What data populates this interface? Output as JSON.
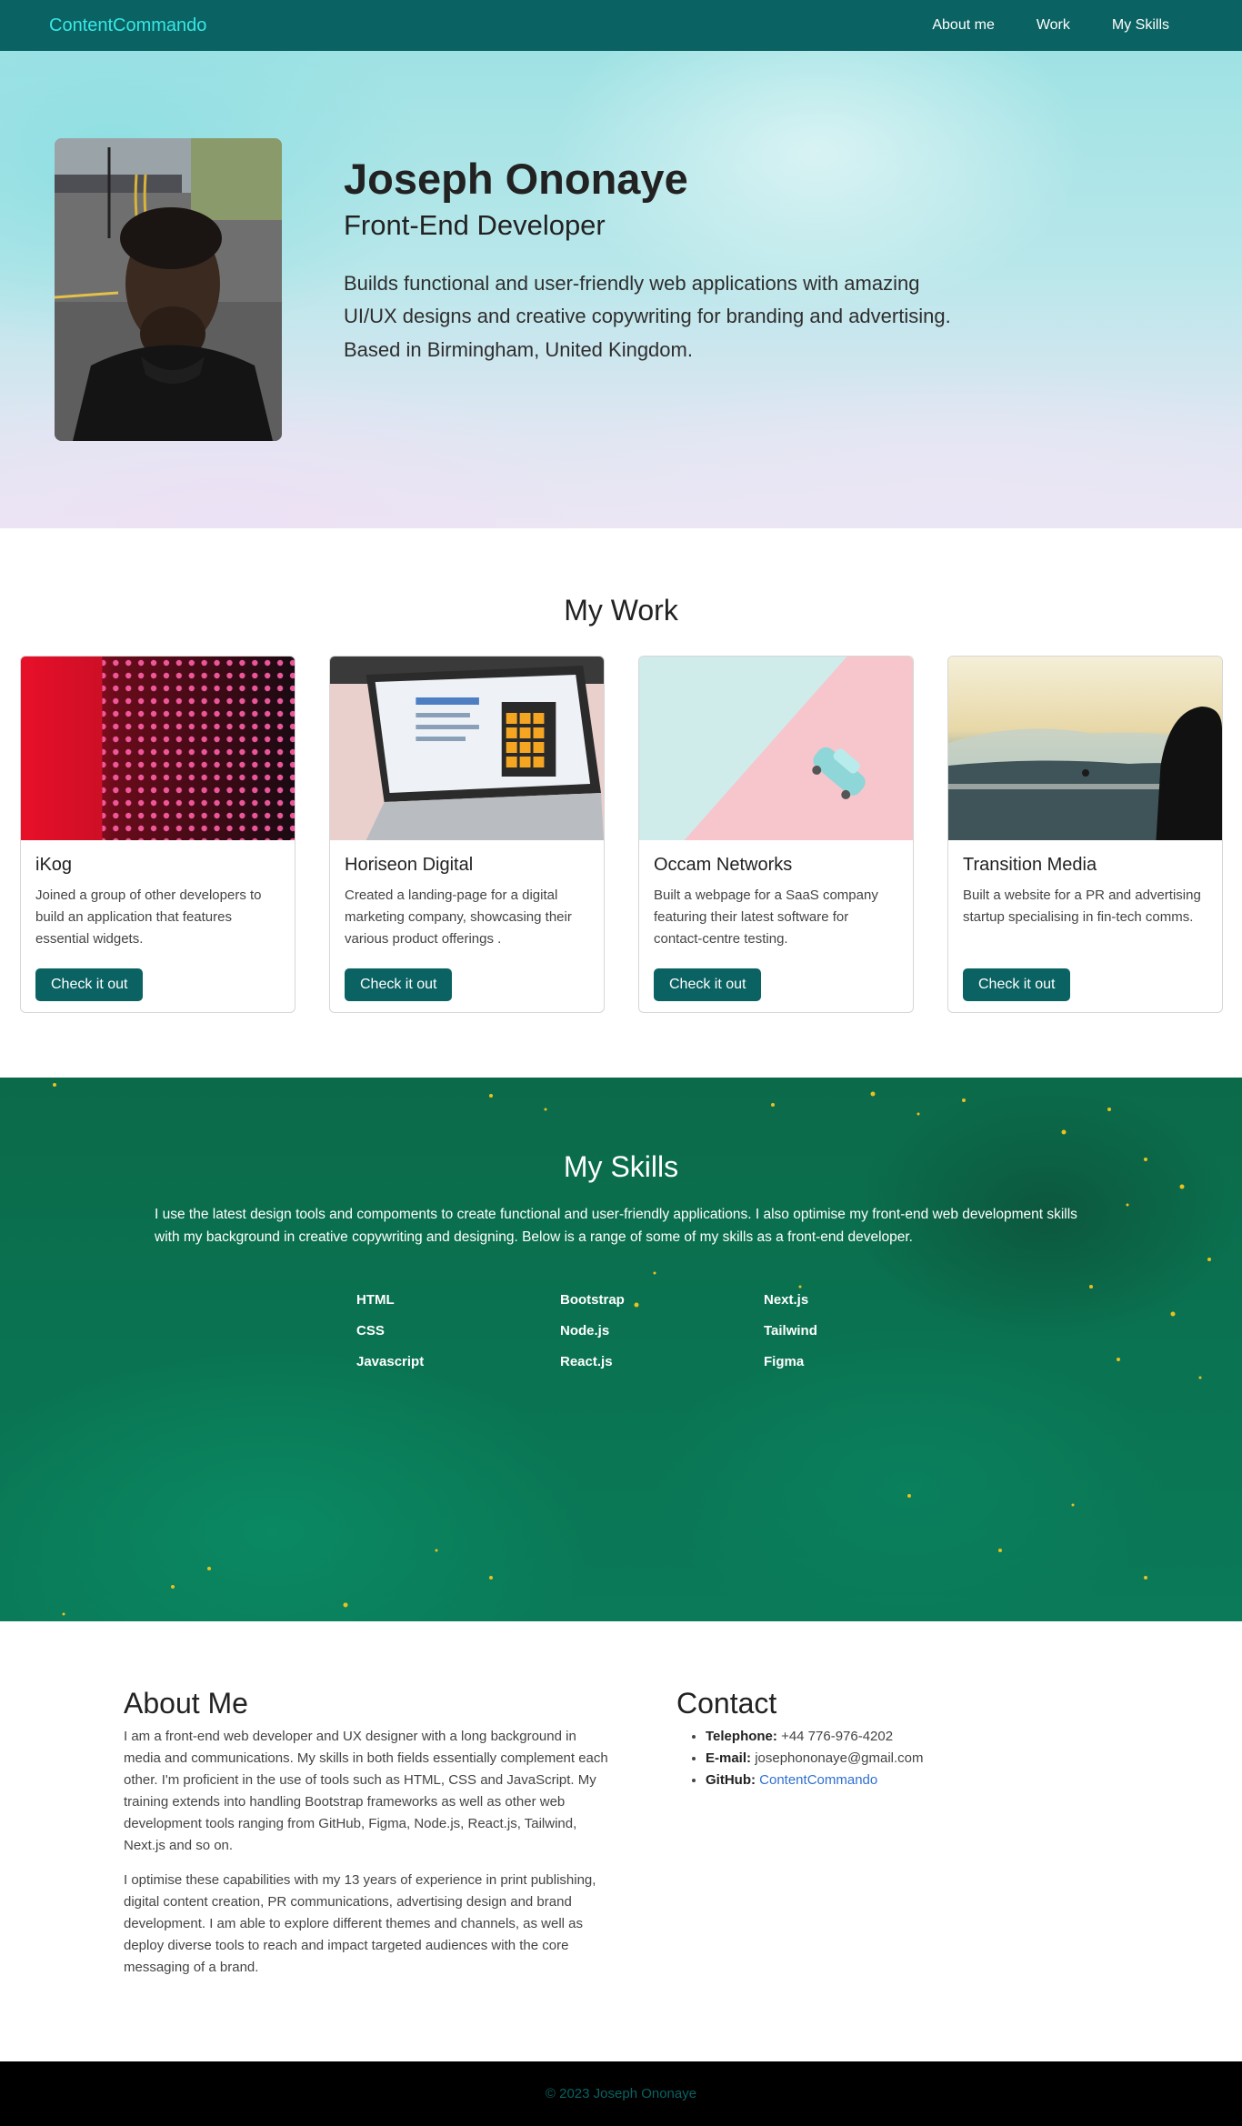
{
  "navbar": {
    "brand": "ContentCommando",
    "links": [
      "About me",
      "Work",
      "My Skills"
    ]
  },
  "hero": {
    "name": "Joseph Ononaye",
    "role": "Front-End Developer",
    "description": "Builds functional and user-friendly web applications with amazing UI/UX designs and creative copywriting for branding and advertising. Based in Birmingham, United Kingdom."
  },
  "work": {
    "title": "My Work",
    "cards": [
      {
        "title": "iKog",
        "text": "Joined a group of other developers to build an application that features essential widgets.",
        "button": "Check it out"
      },
      {
        "title": "Horiseon Digital",
        "text": "Created a landing-page for a digital marketing company, showcasing their various product offerings .",
        "button": "Check it out"
      },
      {
        "title": "Occam Networks",
        "text": "Built a webpage for a SaaS company featuring their latest software for contact-centre testing.",
        "button": "Check it out"
      },
      {
        "title": "Transition Media",
        "text": "Built a website for a PR and advertising startup specialising in fin-tech comms.",
        "button": "Check it out"
      }
    ]
  },
  "skills": {
    "title": "My Skills",
    "intro": "I use the latest design tools and compoments to create functional and user-friendly applications. I also optimise my front-end web development skills with my background in creative copywriting and designing. Below is a range of some of my skills as a front-end developer.",
    "items": [
      "HTML",
      "Bootstrap",
      "Next.js",
      "CSS",
      "Node.js",
      "Tailwind",
      "Javascript",
      "React.js",
      "Figma"
    ]
  },
  "about": {
    "title": "About Me",
    "paragraphs": [
      "I am a front-end web developer and UX designer with a long background in media and communications. My skills in both fields essentially complement each other. I'm proficient in the use of tools such as HTML, CSS and JavaScript. My training extends into handling Bootstrap frameworks as well as other web development tools ranging from GitHub, Figma, Node.js, React.js, Tailwind, Next.js and so on.",
      "I optimise these capabilities with my 13 years of experience in print publishing, digital content creation, PR communications, advertising design and brand development. I am able to explore different themes and channels, as well as deploy diverse tools to reach and impact targeted audiences with the core messaging of a brand."
    ]
  },
  "contact": {
    "title": "Contact",
    "telephone_label": "Telephone:",
    "telephone": "+44 776-976-4202",
    "email_label": "E-mail:",
    "email": "josephononaye@gmail.com",
    "github_label": "GitHub:",
    "github": "ContentCommando"
  },
  "footer": {
    "text": "© 2023 Joseph Ononaye"
  },
  "colors": {
    "primary": "#0b6262",
    "brand_text": "#39e6e6",
    "footer_bg": "#000000",
    "link": "#2f6fd3"
  }
}
